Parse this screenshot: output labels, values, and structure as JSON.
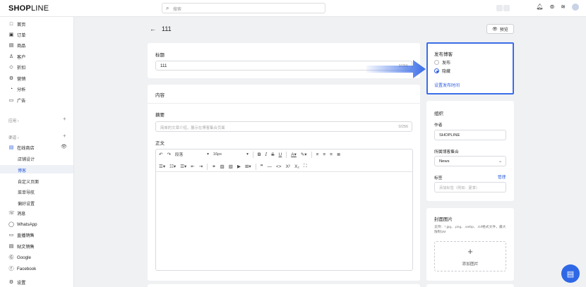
{
  "topbar": {
    "logo_bold": "SHOP",
    "logo_thin": "LINE",
    "search_placeholder": "搜索",
    "icons": [
      "bell-icon",
      "help-icon",
      "wifi-icon",
      "user-avatar-icon"
    ]
  },
  "sidebar": {
    "main_items": [
      {
        "label": "首页",
        "icon": "□"
      },
      {
        "label": "订单",
        "icon": "▣"
      },
      {
        "label": "商品",
        "icon": "▤"
      },
      {
        "label": "客户",
        "icon": "♙"
      },
      {
        "label": "折扣",
        "icon": "◇"
      },
      {
        "label": "营销",
        "icon": "⚙"
      },
      {
        "label": "分析",
        "icon": "◔"
      },
      {
        "label": "广告",
        "icon": "▭"
      }
    ],
    "apps_label": "应用 ›",
    "channels_label": "渠道 ›",
    "online_store": "在线商店",
    "sub_items": [
      {
        "label": "店铺设计",
        "active": false
      },
      {
        "label": "博客",
        "active": true
      },
      {
        "label": "自定义页面",
        "active": false
      },
      {
        "label": "菜单导航",
        "active": false
      },
      {
        "label": "偏好设置",
        "active": false
      }
    ],
    "channel_items": [
      {
        "label": "消息",
        "icon": "☏"
      },
      {
        "label": "WhatsApp",
        "icon": "◯"
      },
      {
        "label": "直播销售",
        "icon": "▭"
      },
      {
        "label": "贴文销售",
        "icon": "▤"
      },
      {
        "label": "Google",
        "icon": "Ⓖ"
      },
      {
        "label": "Facebook",
        "icon": "ⓕ"
      }
    ],
    "settings_label": "设置"
  },
  "header": {
    "back_arrow": "←",
    "title": "111",
    "preview_label": "预览"
  },
  "title_card": {
    "label": "标题",
    "value": "111",
    "counter": "3/255"
  },
  "content_card": {
    "heading": "内容",
    "summary_label": "摘要",
    "summary_placeholder": "简单的文章介绍，展示在博客集合页面",
    "summary_counter": "0/256",
    "body_label": "正文",
    "toolbar": {
      "paragraph": "段落",
      "font_size": "16px"
    }
  },
  "publish_card": {
    "heading": "发布博客",
    "options": [
      {
        "label": "发布",
        "selected": false
      },
      {
        "label": "隐藏",
        "selected": true
      }
    ],
    "schedule_link": "设置发布时间"
  },
  "org_card": {
    "heading": "组织",
    "author_label": "作者",
    "author_value": "SHOPLINE",
    "collection_label": "所属博客集合",
    "collection_value": "News",
    "tags_label": "标签",
    "tags_manage": "管理",
    "tags_placeholder": "添加标签（例如：夏季）"
  },
  "cover_card": {
    "heading": "封面图片",
    "hint": "支持：*.jpg、.png、.webp、.Gif格式文件，最大限制1M",
    "plus": "+",
    "upload_label": "添加图片"
  },
  "colors": {
    "accent": "#2f5fe0",
    "highlight": "#3b6de8",
    "chat": "#2f68e6"
  }
}
